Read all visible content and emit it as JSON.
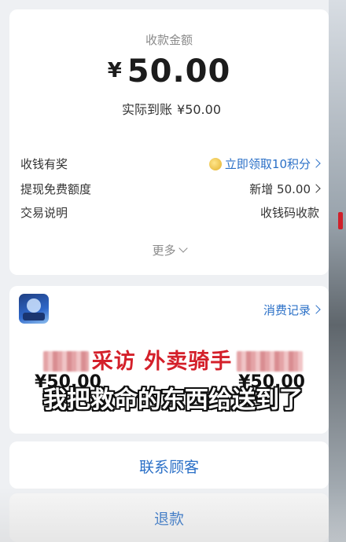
{
  "payment": {
    "amount_label": "收款金额",
    "currency": "¥",
    "amount": "50.00",
    "actual_label": "实际到账",
    "actual_value": "¥50.00"
  },
  "details": [
    {
      "key": "收钱有奖",
      "value": "立即领取10积分",
      "link": true,
      "icon": "coin-icon"
    },
    {
      "key": "提现免费额度",
      "value": "新增 50.00",
      "link": false
    },
    {
      "key": "交易说明",
      "value": "收钱码收款",
      "link": false
    }
  ],
  "more_label": "更多",
  "record_label": "消费记录",
  "values": {
    "left": "¥50.00",
    "right": "¥50.00"
  },
  "overlay": {
    "title_a": "采访",
    "title_b": "外卖骑手",
    "subtitle": "我把救命的东西给送到了"
  },
  "actions": {
    "contact": "联系顾客",
    "refund": "退款"
  },
  "colors": {
    "link": "#2b70c7",
    "overlay_red": "#d4202a"
  }
}
